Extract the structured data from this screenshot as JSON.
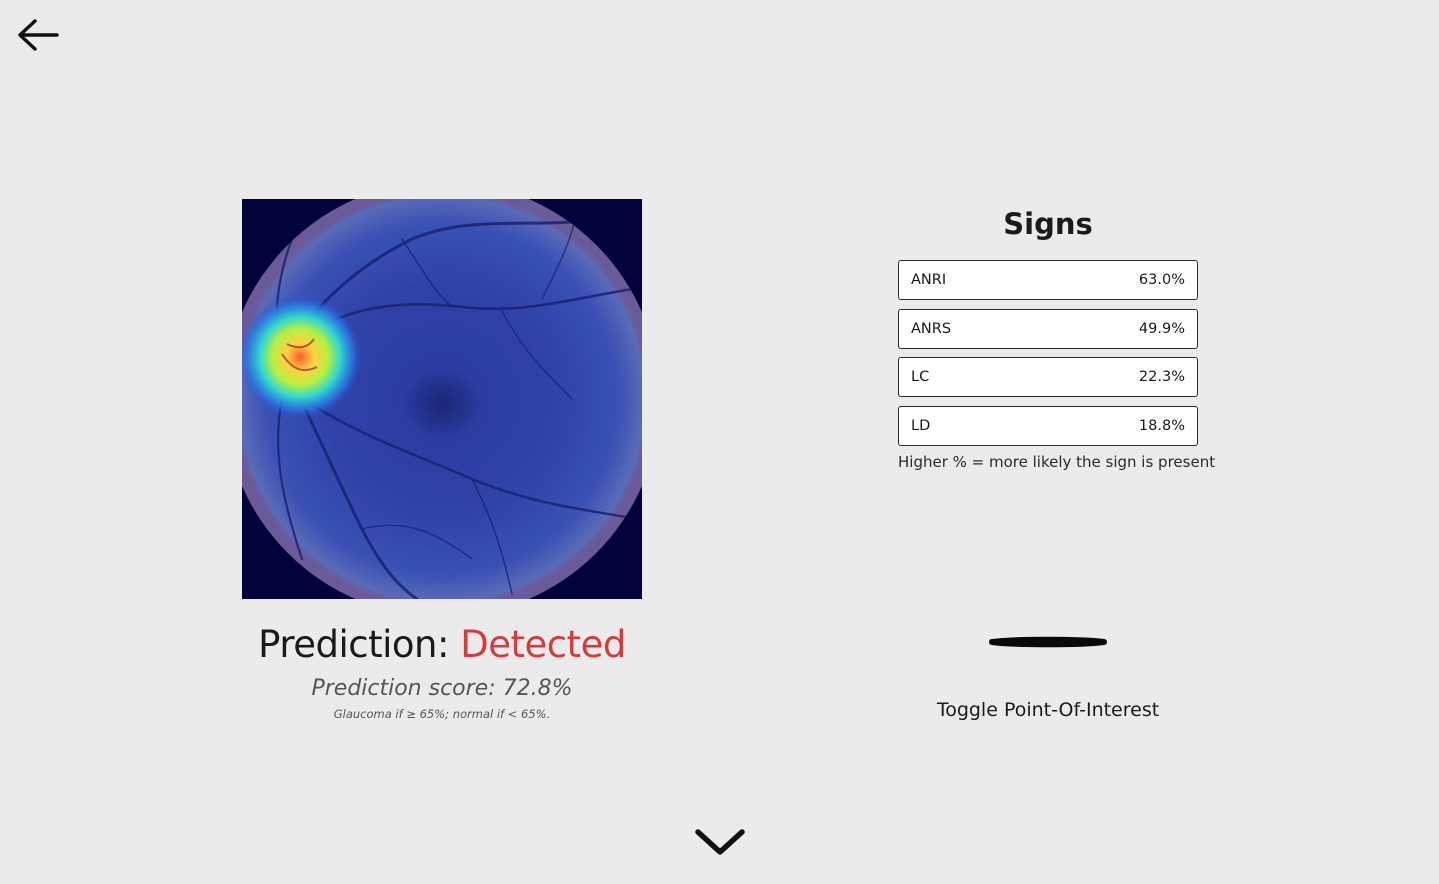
{
  "navigation": {
    "back_icon": "arrow-left-icon"
  },
  "image": {
    "icon": "retina-heatmap-image"
  },
  "prediction": {
    "label": "Prediction:",
    "status": "Detected",
    "status_color": "#d13c3c",
    "score_text": "Prediction score: 72.8%",
    "threshold_note": "Glaucoma if ≥ 65%; normal if < 65%."
  },
  "signs": {
    "heading": "Signs",
    "items": [
      {
        "name": "ANRI",
        "value": "63.0%"
      },
      {
        "name": "ANRS",
        "value": "49.9%"
      },
      {
        "name": "LC",
        "value": "22.3%"
      },
      {
        "name": "LD",
        "value": "18.8%"
      }
    ],
    "note": "Higher % = more likely the sign is present"
  },
  "toggle": {
    "label": "Toggle Point-Of-Interest",
    "icon": "toggle-off-icon"
  },
  "scroll": {
    "icon": "chevron-down-icon"
  }
}
